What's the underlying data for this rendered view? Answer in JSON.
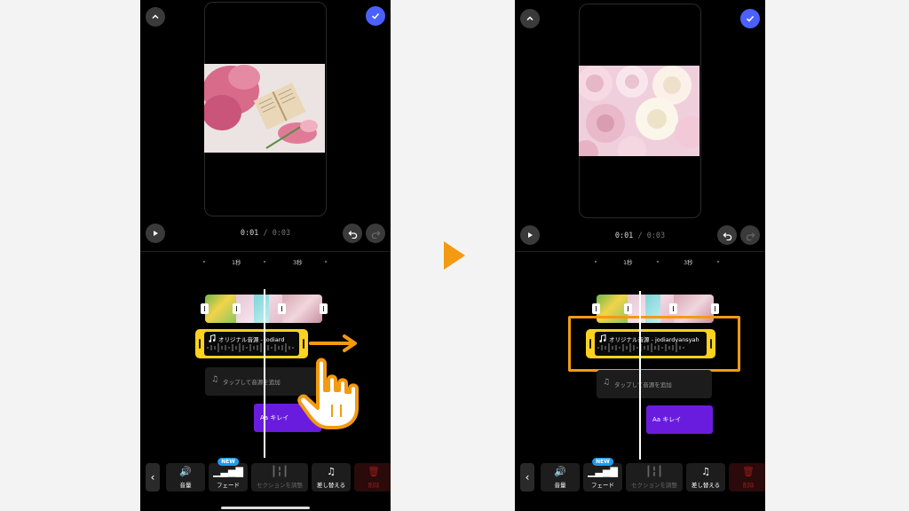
{
  "colors": {
    "accent_blue": "#4a61ff",
    "audio_yellow": "#ffd21f",
    "text_clip_purple": "#6a1cde",
    "annotation_orange": "#f39a12",
    "new_badge": "#1e9bf0"
  },
  "step_arrow_icon": "triangle-right",
  "left": {
    "time_current": "0:01",
    "time_sep": "/",
    "time_total": "0:03",
    "ruler_1": "1秒",
    "ruler_2": "3秒",
    "audio_title": "オリジナル音源 - jodiard",
    "add_audio": "タップして音源を追加",
    "text_clip": "Aa  キレイ",
    "drag_hint_icon": "hand-pointer",
    "drag_arrow_icon": "arrow-right"
  },
  "right": {
    "time_current": "0:01",
    "time_sep": "/",
    "time_total": "0:03",
    "ruler_1": "1秒",
    "ruler_2": "3秒",
    "audio_title": "オリジナル音源 - jodiardyansyah",
    "add_audio": "タップして音源を追加",
    "text_clip": "Aa  キレイ"
  },
  "toolbar": {
    "back_icon": "chevron-left",
    "volume": "音量",
    "fade": "フェード",
    "new_badge": "NEW",
    "adjust_section": "セクションを調整",
    "replace": "差し替える",
    "delete": "削除"
  }
}
